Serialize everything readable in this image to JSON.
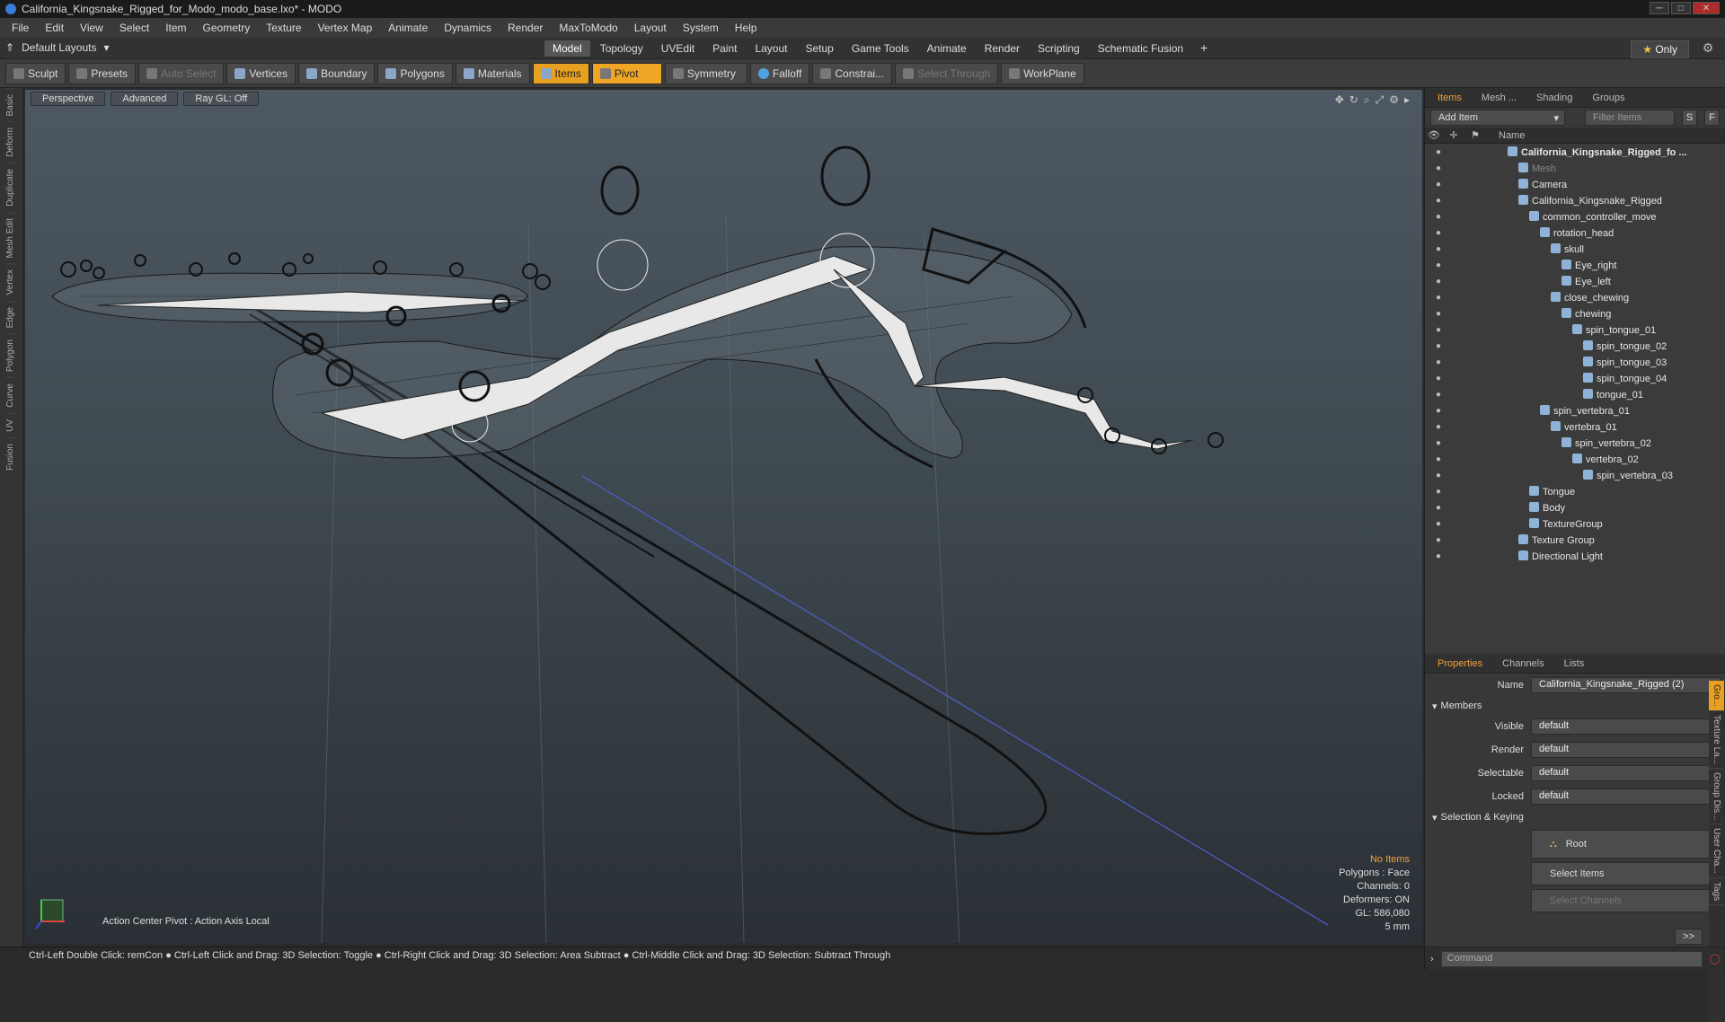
{
  "window": {
    "title": "California_Kingsnake_Rigged_for_Modo_modo_base.lxo* - MODO"
  },
  "menu": [
    "File",
    "Edit",
    "View",
    "Select",
    "Item",
    "Geometry",
    "Texture",
    "Vertex Map",
    "Animate",
    "Dynamics",
    "Render",
    "MaxToModo",
    "Layout",
    "System",
    "Help"
  ],
  "layout": {
    "dropdown": "Default Layouts",
    "tabs": [
      "Model",
      "Topology",
      "UVEdit",
      "Paint",
      "Layout",
      "Setup",
      "Game Tools",
      "Animate",
      "Render",
      "Scripting",
      "Schematic Fusion"
    ],
    "active_tab": "Model",
    "only_label": "Only"
  },
  "toolbar": {
    "sculpt": "Sculpt",
    "presets": "Presets",
    "auto_select": "Auto Select",
    "vertices": "Vertices",
    "boundary": "Boundary",
    "polygons": "Polygons",
    "materials": "Materials",
    "items": "Items",
    "pivot": "Pivot",
    "symmetry": "Symmetry",
    "falloff": "Falloff",
    "constraints": "Constrai...",
    "select_through": "Select Through",
    "workplane": "WorkPlane"
  },
  "left_strip": [
    "Basic",
    "Deform",
    "Duplicate",
    "Mesh Edit",
    "Vertex",
    "Edge",
    "Polygon",
    "Curve",
    "UV",
    "Fusion"
  ],
  "viewport": {
    "perspective": "Perspective",
    "advanced": "Advanced",
    "raygl": "Ray GL: Off",
    "action_center": "Action Center Pivot : Action Axis Local",
    "info": {
      "no_items": "No Items",
      "polygons": "Polygons : Face",
      "channels": "Channels: 0",
      "deformers": "Deformers: ON",
      "gl": "GL: 586,080",
      "scale": "5 mm"
    }
  },
  "statusbar": "Ctrl-Left Double Click: remCon ● Ctrl-Left Click and Drag: 3D Selection: Toggle ● Ctrl-Right Click and Drag: 3D Selection: Area Subtract ● Ctrl-Middle Click and Drag: 3D Selection: Subtract Through",
  "items_panel": {
    "tabs": [
      "Items",
      "Mesh ...",
      "Shading",
      "Groups"
    ],
    "active_tab": "Items",
    "add_item": "Add Item",
    "filter": "Filter Items",
    "s_btn": "S",
    "f_btn": "F",
    "col_name": "Name",
    "tree": [
      {
        "label": "California_Kingsnake_Rigged_fo ...",
        "depth": 0,
        "bold": true
      },
      {
        "label": "Mesh",
        "depth": 1,
        "dim": true
      },
      {
        "label": "Camera",
        "depth": 1
      },
      {
        "label": "California_Kingsnake_Rigged",
        "depth": 1
      },
      {
        "label": "common_controller_move",
        "depth": 2
      },
      {
        "label": "rotation_head",
        "depth": 3
      },
      {
        "label": "skull",
        "depth": 4
      },
      {
        "label": "Eye_right",
        "depth": 5
      },
      {
        "label": "Eye_left",
        "depth": 5
      },
      {
        "label": "close_chewing",
        "depth": 4
      },
      {
        "label": "chewing",
        "depth": 5
      },
      {
        "label": "spin_tongue_01",
        "depth": 6
      },
      {
        "label": "spin_tongue_02",
        "depth": 7
      },
      {
        "label": "spin_tongue_03",
        "depth": 7
      },
      {
        "label": "spin_tongue_04",
        "depth": 7
      },
      {
        "label": "tongue_01",
        "depth": 7
      },
      {
        "label": "spin_vertebra_01",
        "depth": 3
      },
      {
        "label": "vertebra_01",
        "depth": 4
      },
      {
        "label": "spin_vertebra_02",
        "depth": 5
      },
      {
        "label": "vertebra_02",
        "depth": 6
      },
      {
        "label": "spin_vertebra_03",
        "depth": 7
      },
      {
        "label": "Tongue",
        "depth": 2
      },
      {
        "label": "Body",
        "depth": 2
      },
      {
        "label": "TextureGroup",
        "depth": 2
      },
      {
        "label": "Texture Group",
        "depth": 1
      },
      {
        "label": "Directional Light",
        "depth": 1
      }
    ]
  },
  "properties_panel": {
    "tabs": [
      "Properties",
      "Channels",
      "Lists"
    ],
    "active_tab": "Properties",
    "name_label": "Name",
    "name_value": "California_Kingsnake_Rigged (2)",
    "members_section": "Members",
    "fields": [
      {
        "label": "Visible",
        "value": "default"
      },
      {
        "label": "Render",
        "value": "default"
      },
      {
        "label": "Selectable",
        "value": "default"
      },
      {
        "label": "Locked",
        "value": "default"
      }
    ],
    "keying_section": "Selection & Keying",
    "root_btn": "Root",
    "select_items_btn": "Select Items",
    "select_channels_btn": "Select Channels",
    "more_btn": ">>",
    "side_tabs": [
      "Gro...",
      "Texture La...",
      "Group Dis...",
      "User Cha...",
      "Tags"
    ],
    "command_placeholder": "Command"
  }
}
